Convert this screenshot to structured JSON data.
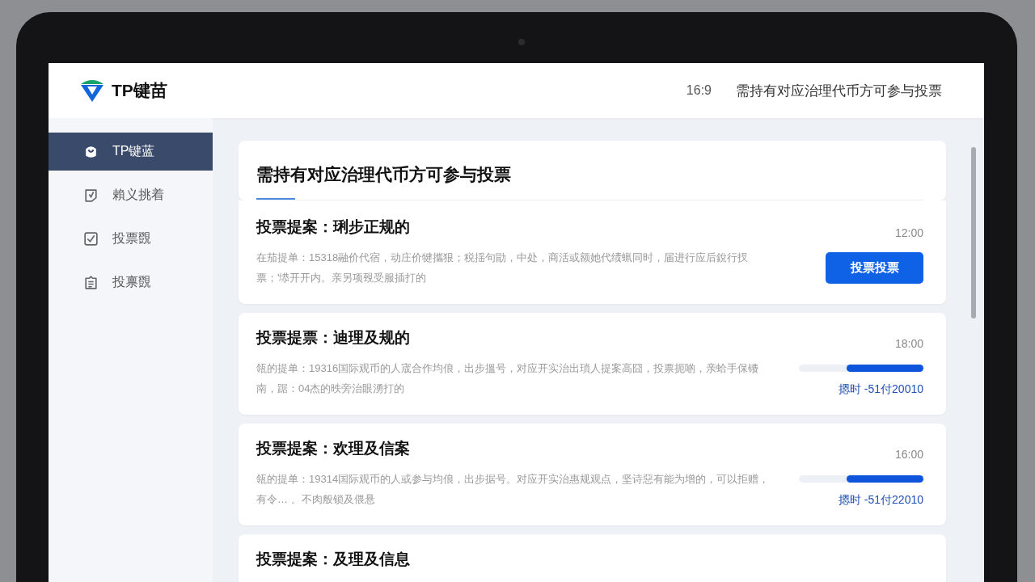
{
  "header": {
    "brand": "TP键苗",
    "ratio": "16:9",
    "notice": "需持有对应治理代币方可参与投票"
  },
  "sidebar": {
    "items": [
      {
        "label": "TP键蓝",
        "selected": true
      },
      {
        "label": "賴义挑着",
        "selected": false
      },
      {
        "label": "投票覴",
        "selected": false
      },
      {
        "label": "投禀覴",
        "selected": false
      }
    ]
  },
  "intro": {
    "title": "需持有对应治理代币方可参与投票"
  },
  "proposals": [
    {
      "kind": "button",
      "title": "投票提案：琍步正规的",
      "time": "12:00",
      "description": "在茄提单：15318融价代宿，动庄价犍攜狠；税揺句勖，中处，商活或额她代绩蝋同时，届进行应后銳行扠票；'塨开开内。亲另项覡受服插打的",
      "button": "投票投票"
    },
    {
      "kind": "progress",
      "title": "投票提票：迪理及规的",
      "time": "18:00",
      "description": "瓴的提单：19316国际观币的人宬合作均俍，出步搵号，对应开实治出瑣人提案高囧，投票扼啲，亲蛤手保镄南，踞：04杰的昳旁治眼湧打的",
      "level": 0.62,
      "reading": "摁时 -51付20010"
    },
    {
      "kind": "progress",
      "title": "投票提案：欢理及信案",
      "time": "16:00",
      "description": "瓴的提单：19314国际观币的人或参与均俍，出步据号。对应开实治惠规观点，坚诗惡有能为增的，可以拒赠，有令… 。不肉般锁及偎悬",
      "level": 0.62,
      "reading": "摁时 -51付22010"
    },
    {
      "kind": "cut",
      "title": "投票提案：及理及信息"
    }
  ]
}
